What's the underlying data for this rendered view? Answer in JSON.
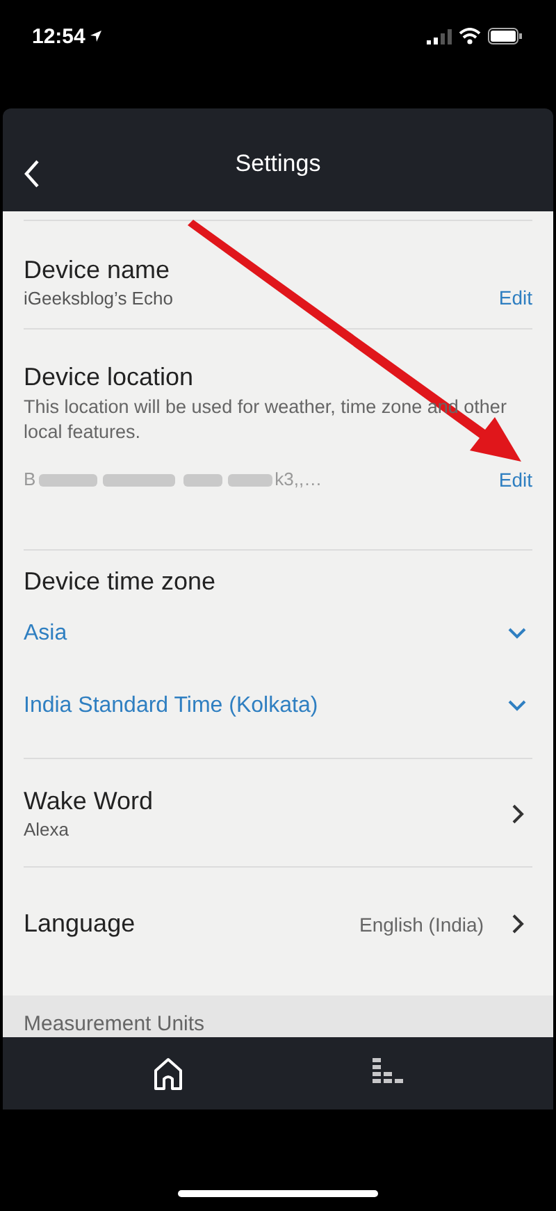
{
  "status_bar": {
    "time": "12:54"
  },
  "header": {
    "title": "Settings"
  },
  "device_name": {
    "title": "Device name",
    "value": "iGeeksblog’s Echo",
    "action": "Edit"
  },
  "device_location": {
    "title": "Device location",
    "description": "This location will be used for weather, time zone and other local features.",
    "address_start": "B",
    "address_end": "k3,,…",
    "action": "Edit"
  },
  "time_zone": {
    "title": "Device time zone",
    "dropdowns": [
      "Asia",
      "India Standard Time (Kolkata)"
    ]
  },
  "wake_word": {
    "title": "Wake Word",
    "value": "Alexa"
  },
  "language": {
    "title": "Language",
    "value": "English (India)"
  },
  "section_header": "Measurement Units",
  "tab_bar": [
    {
      "kind": "home",
      "selected": true
    },
    {
      "kind": "activity",
      "selected": false
    }
  ]
}
